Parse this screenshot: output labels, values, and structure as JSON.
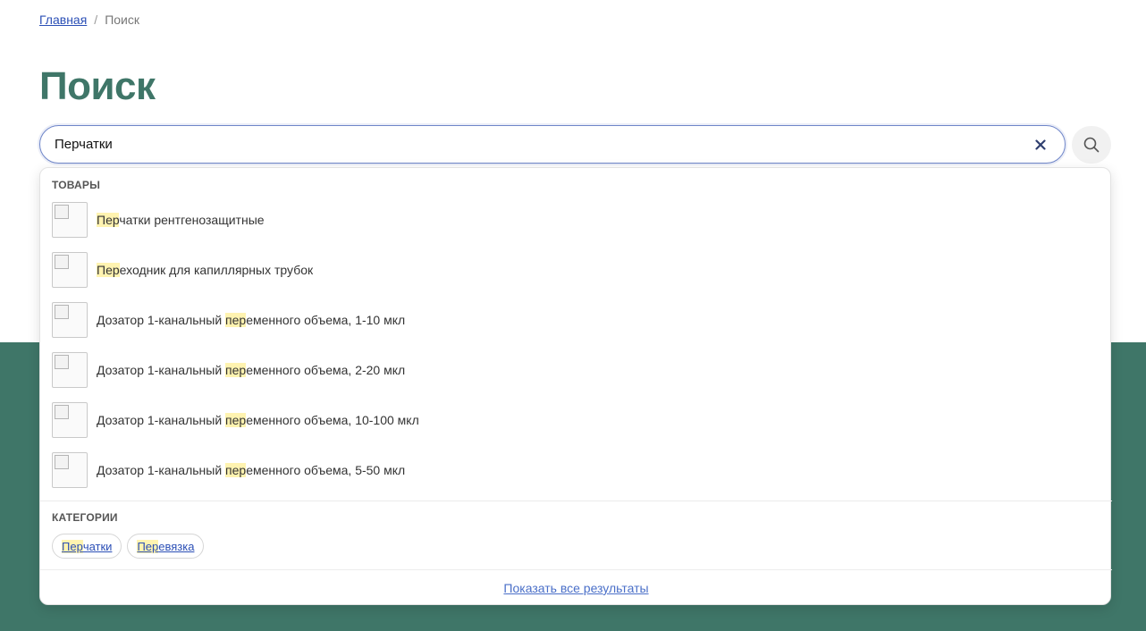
{
  "breadcrumb": {
    "home": "Главная",
    "separator": "/",
    "current": "Поиск"
  },
  "page_title": "Поиск",
  "search": {
    "value": "Перчатки",
    "clear_icon": "close-icon",
    "submit_icon": "search-icon"
  },
  "dropdown": {
    "products_title": "ТОВАРЫ",
    "products": [
      {
        "pre": "",
        "hl": "Пер",
        "post": "чатки рентгенозащитные"
      },
      {
        "pre": "",
        "hl": "Пер",
        "post": "еходник для капиллярных трубок"
      },
      {
        "pre": "Дозатор 1-канальный ",
        "hl": "пер",
        "post": "еменного объема, 1-10 мкл"
      },
      {
        "pre": "Дозатор 1-канальный ",
        "hl": "пер",
        "post": "еменного объема, 2-20 мкл"
      },
      {
        "pre": "Дозатор 1-канальный ",
        "hl": "пер",
        "post": "еменного объема, 10-100 мкл"
      },
      {
        "pre": "Дозатор 1-канальный ",
        "hl": "пер",
        "post": "еменного объема, 5-50 мкл"
      }
    ],
    "categories_title": "КАТЕГОРИИ",
    "categories": [
      {
        "hl": "Пер",
        "post": "чатки"
      },
      {
        "hl": "Пер",
        "post": "евязка"
      }
    ],
    "show_all": "Показать все результаты"
  },
  "colors": {
    "brand_green": "#3f7668",
    "link_blue": "#2b4fb6",
    "highlight": "#fff3b0"
  }
}
